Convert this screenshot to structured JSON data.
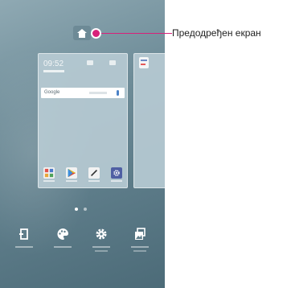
{
  "callout": {
    "label": "Предодређен екран"
  },
  "preview": {
    "time": "09:52",
    "search_logo": "Google"
  },
  "dock": {
    "items": [
      {
        "name": "widgets",
        "icon": "widget-icon"
      },
      {
        "name": "themes",
        "icon": "palette-icon"
      },
      {
        "name": "settings",
        "icon": "gear-icon"
      },
      {
        "name": "wallpapers",
        "icon": "wallpaper-icon"
      }
    ]
  },
  "colors": {
    "marker": "#d8217a",
    "wallpaper": "#6f8d99"
  }
}
